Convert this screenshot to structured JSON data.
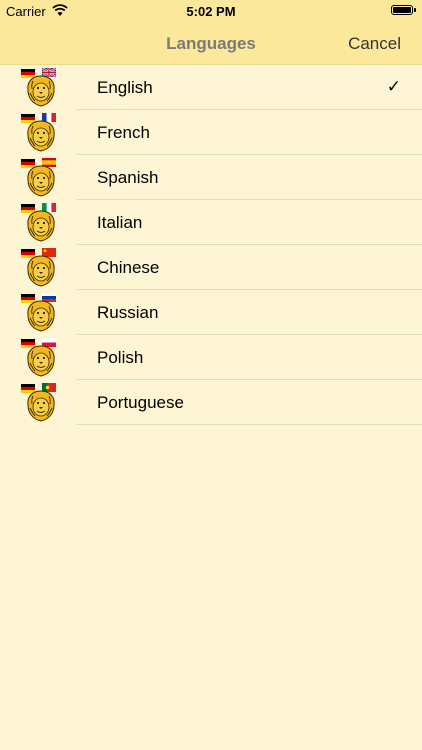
{
  "status_bar": {
    "carrier": "Carrier",
    "time": "5:02 PM",
    "wifi_icon": "wifi-icon",
    "battery_icon": "battery-icon"
  },
  "nav": {
    "title": "Languages",
    "cancel": "Cancel"
  },
  "colors": {
    "bar_background": "#fce89a",
    "list_background": "#fdf5d4",
    "title_color": "#7a7a7a"
  },
  "languages": [
    {
      "label": "English",
      "selected": true,
      "icon": "lion-flag-de-uk-icon"
    },
    {
      "label": "French",
      "selected": false,
      "icon": "lion-flag-de-fr-icon"
    },
    {
      "label": "Spanish",
      "selected": false,
      "icon": "lion-flag-de-es-icon"
    },
    {
      "label": "Italian",
      "selected": false,
      "icon": "lion-flag-de-it-icon"
    },
    {
      "label": "Chinese",
      "selected": false,
      "icon": "lion-flag-de-cn-icon"
    },
    {
      "label": "Russian",
      "selected": false,
      "icon": "lion-flag-de-ru-icon"
    },
    {
      "label": "Polish",
      "selected": false,
      "icon": "lion-flag-de-pl-icon"
    },
    {
      "label": "Portuguese",
      "selected": false,
      "icon": "lion-flag-de-pt-icon"
    }
  ],
  "checkmark": "✓"
}
